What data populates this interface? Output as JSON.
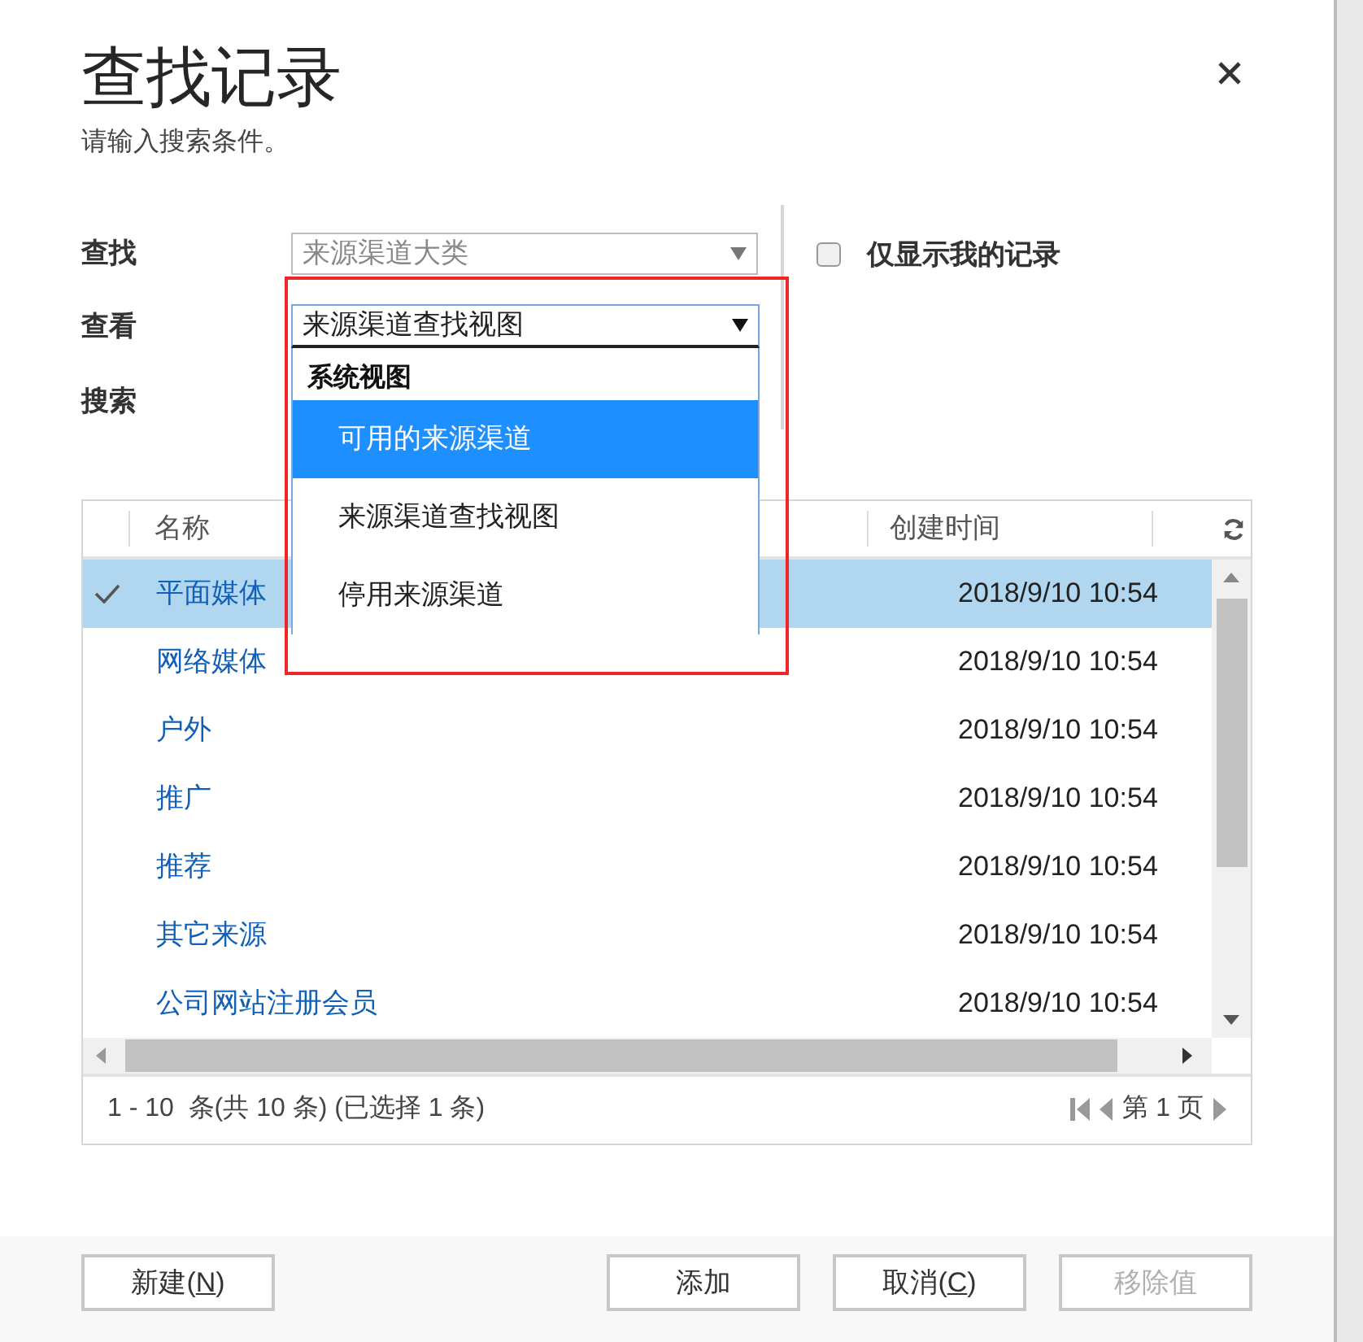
{
  "dialog": {
    "title": "查找记录",
    "subtitle": "请输入搜索条件。"
  },
  "form": {
    "find_label": "查找",
    "find_value": "来源渠道大类",
    "view_label": "查看",
    "view_value": "来源渠道查找视图",
    "search_label": "搜索",
    "only_mine": {
      "label": "仅显示我的记录",
      "checked": false
    }
  },
  "view_dropdown": {
    "expanded": true,
    "group": "系统视图",
    "options": [
      {
        "label": "可用的来源渠道",
        "selected": true
      },
      {
        "label": "来源渠道查找视图",
        "selected": false
      },
      {
        "label": "停用来源渠道",
        "selected": false
      }
    ]
  },
  "table": {
    "columns": [
      "名称",
      "创建时间"
    ],
    "rows": [
      {
        "name": "平面媒体",
        "created": "2018/9/10 10:54",
        "selected": true
      },
      {
        "name": "网络媒体",
        "created": "2018/9/10 10:54",
        "selected": false
      },
      {
        "name": "户外",
        "created": "2018/9/10 10:54",
        "selected": false
      },
      {
        "name": "推广",
        "created": "2018/9/10 10:54",
        "selected": false
      },
      {
        "name": "推荐",
        "created": "2018/9/10 10:54",
        "selected": false
      },
      {
        "name": "其它来源",
        "created": "2018/9/10 10:54",
        "selected": false
      },
      {
        "name": "公司网站注册会员",
        "created": "2018/9/10 10:54",
        "selected": false
      }
    ],
    "status": "1 - 10  条(共 10 条) (已选择 1 条)",
    "page": "第 1 页"
  },
  "buttons": [
    {
      "label": "新建(N)",
      "underline_key": true,
      "disabled": false
    },
    {
      "label": "添加",
      "underline_key": false,
      "disabled": false
    },
    {
      "label": "取消(C)",
      "underline_key": true,
      "disabled": false
    },
    {
      "label": "移除值",
      "underline_key": false,
      "disabled": true
    }
  ]
}
